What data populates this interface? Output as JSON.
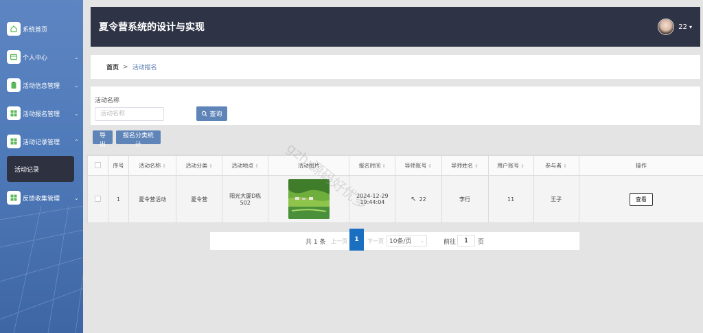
{
  "sidebar": {
    "items": [
      {
        "label": "系统首页",
        "icon": "home-icon",
        "has_arrow": false
      },
      {
        "label": "个人中心",
        "icon": "profile-card-icon",
        "has_arrow": true
      },
      {
        "label": "活动信息管理",
        "icon": "clipboard-icon",
        "has_arrow": true
      },
      {
        "label": "活动报名管理",
        "icon": "grid-icon",
        "has_arrow": true
      },
      {
        "label": "活动记录管理",
        "icon": "grid-icon",
        "has_arrow": true,
        "expanded": true
      },
      {
        "label": "反馈收集管理",
        "icon": "grid-icon",
        "has_arrow": true
      }
    ],
    "active_subitem": "活动记录"
  },
  "header": {
    "title": "夏令营系统的设计与实现",
    "username": "22"
  },
  "breadcrumb": {
    "home": "首页",
    "separator": ">",
    "current": "活动报名"
  },
  "search": {
    "label": "活动名称",
    "placeholder": "活动名称",
    "button": "查询"
  },
  "actions": {
    "export": "导出",
    "stats": "报名分类统计"
  },
  "table": {
    "columns": [
      "序号",
      "活动名称",
      "活动分类",
      "活动地点",
      "活动图片",
      "报名时间",
      "导师账号",
      "导师姓名",
      "用户账号",
      "参与者",
      "操作"
    ],
    "rows": [
      {
        "index": "1",
        "name": "夏令营活动",
        "category": "夏令营",
        "location": "阳光大厦D栋502",
        "time": "2024-12-29 19:44:04",
        "mentor_account": "22",
        "mentor_name": "李行",
        "user_account": "11",
        "participant": "王子",
        "action": "查看"
      }
    ]
  },
  "pagination": {
    "total": "共 1 条",
    "prev": "上一页",
    "current": "1",
    "next": "下一页",
    "page_size": "10条/页",
    "goto_prefix": "前往",
    "goto_value": "1",
    "goto_suffix": "页"
  },
  "watermark": "gzh:源码好优多",
  "colors": {
    "sidebar": "#4f7ab9",
    "header": "#2e3445",
    "primary_button": "#5f84b8",
    "active_page": "#1b6fc1"
  }
}
